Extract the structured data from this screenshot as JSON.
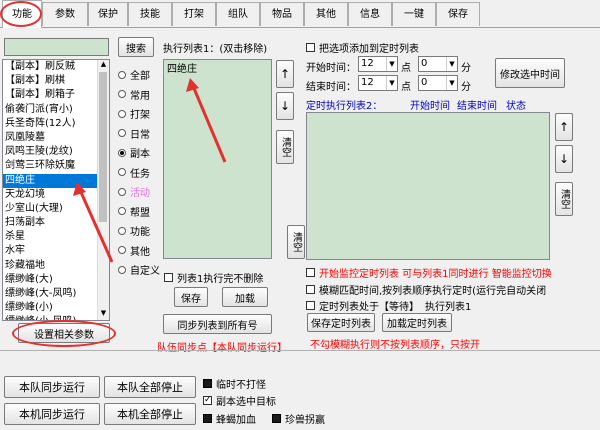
{
  "tabs": [
    "功能",
    "参数",
    "保护",
    "技能",
    "打架",
    "组队",
    "物品",
    "其他",
    "信息",
    "一键",
    "保存"
  ],
  "left": {
    "search_value": "",
    "search_button": "搜索",
    "items": [
      "【副本】刷反贼",
      "【副本】刷棋",
      "【副本】刷箱子",
      "偷袭门派(宵小)",
      "兵圣奇阵(12人)",
      "凤凰陵墓",
      "凤鸣王陵(龙纹)",
      "剑莺三环除妖魔",
      "四绝庄",
      "天龙幻境",
      "少室山(大理)",
      "扫荡副本",
      "杀星",
      "水牢",
      "珍藏福地",
      "缥缈峰(大)",
      "缥缈峰(大-凤鸣)",
      "缥缈峰(小)",
      "缥缈峰(小-凤鸣)"
    ],
    "selected": "四绝庄",
    "settings_button": "设置相关参数"
  },
  "radios": [
    "全部",
    "常用",
    "打架",
    "日常",
    "副本",
    "任务",
    "活动",
    "帮盟",
    "功能",
    "其他",
    "自定义"
  ],
  "radio_selected": "副本",
  "list1": {
    "title": "执行列表1：(双击移除)",
    "items": [
      "四绝庄"
    ],
    "clear": "清空",
    "up": "↑",
    "down": "↓",
    "nodelete_label": "列表1执行完不删除",
    "save": "保存",
    "load": "加载",
    "sync_all": "同步列表到所有号",
    "team_sync_note": "队伍同步点【本队同步运行】"
  },
  "timer": {
    "add_label": "把选项添加到定时列表",
    "start_label": "开始时间：",
    "end_label": "结束时间：",
    "start_hour": "12",
    "start_min": "0",
    "end_hour": "12",
    "end_min": "0",
    "hour_unit": "点",
    "min_unit": "分",
    "modify": "修改选中时间",
    "list2_title": "定时执行列表2：",
    "col_start": "开始时间",
    "col_end": "结束时间",
    "col_status": "状态",
    "clear": "清空",
    "up": "↑",
    "down": "↓",
    "opt1": "开始监控定时列表 可与列表1同时进行 智能监控切换",
    "opt2": "模糊匹配时间,按列表顺序执行定时(运行完自动关闭",
    "opt3_prefix": "定时列表处于【等待】",
    "opt3_suffix": "执行列表1",
    "save": "保存定时列表",
    "load": "加载定时列表",
    "note": "不勾模糊执行则不按列表顺序，只按开"
  },
  "bottom": {
    "team_sync_run": "本队同步运行",
    "team_stop_all": "本队全部停止",
    "local_sync_run": "本机同步运行",
    "local_stop_all": "本机全部停止",
    "opt_no_fight": "临时不打怪",
    "opt_dungeon_target": "副本选中目标",
    "opt_bee_heal": "蜂蝎加血",
    "opt_pet_skip": "珍兽拐赢"
  }
}
